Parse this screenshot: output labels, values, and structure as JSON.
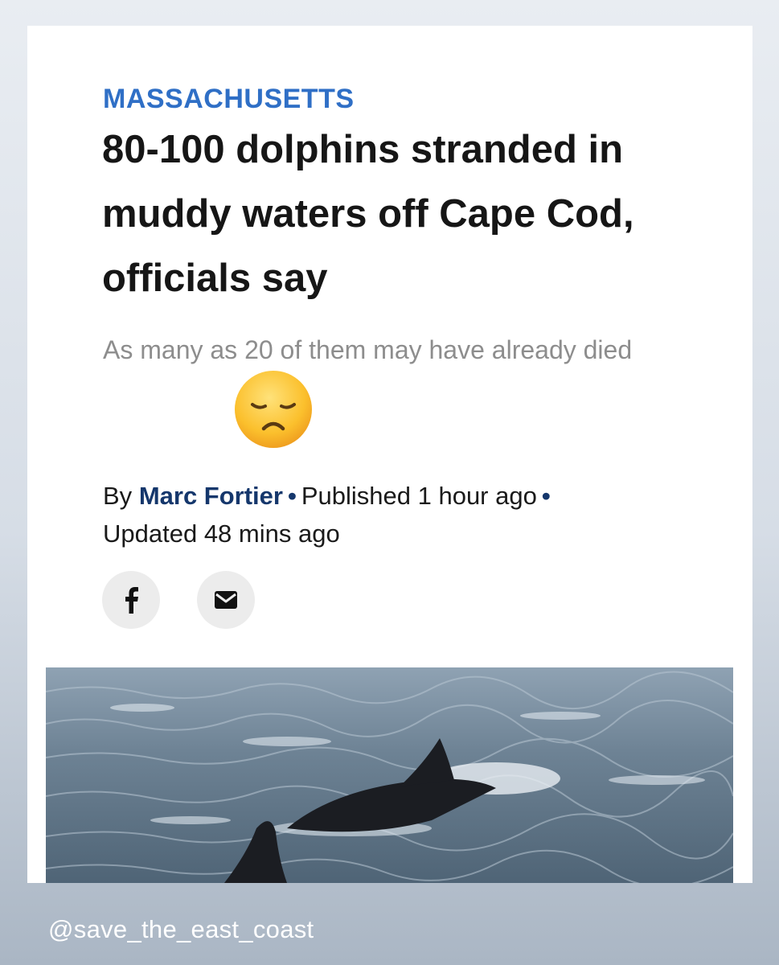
{
  "article": {
    "section": "MASSACHUSETTS",
    "headline": "80-100 dolphins stranded in muddy waters off Cape Cod, officials say",
    "dek": "As many as 20 of them may have already died",
    "byline": {
      "prefix": "By",
      "author": "Marc Fortier",
      "separator": "•",
      "published": "Published 1 hour ago",
      "updated": "Updated 48 mins ago"
    },
    "share_icons": [
      "facebook-icon",
      "email-icon"
    ],
    "emoji": "disappointed-face-emoji"
  },
  "watermark": "@save_the_east_coast",
  "colors": {
    "section_blue": "#2f6fc6",
    "author_navy": "#15376c",
    "headline": "#161616",
    "dek_gray": "#8d8d8d"
  }
}
